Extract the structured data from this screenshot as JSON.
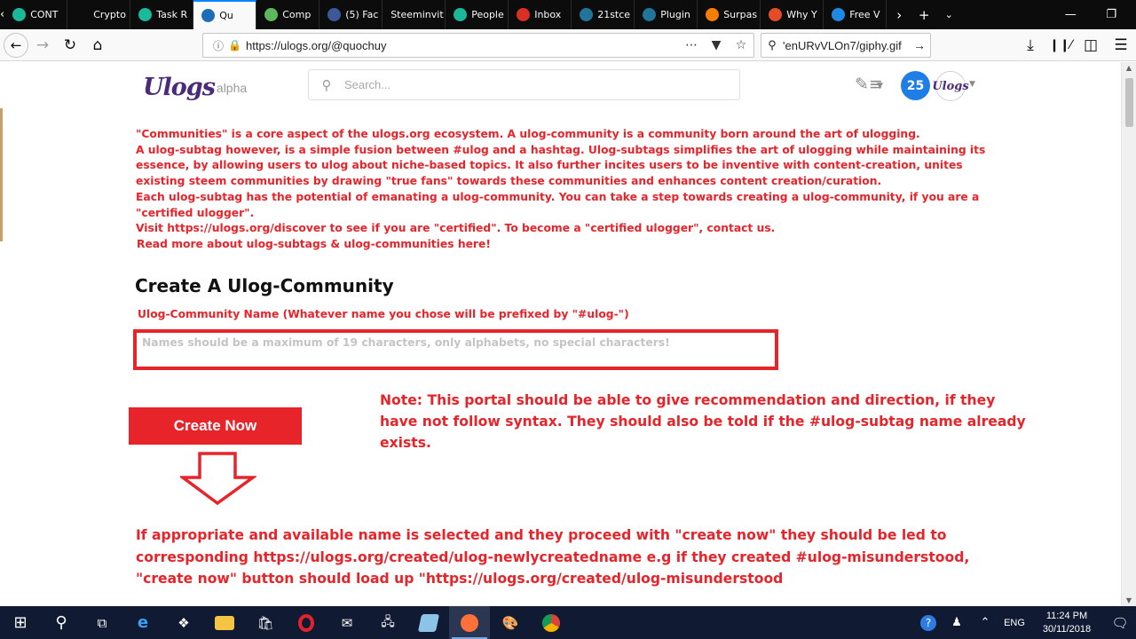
{
  "browser": {
    "tabs": [
      {
        "label": "CONT",
        "favicon": "circle-swirl-icon",
        "color": "#19b999",
        "active": false
      },
      {
        "label": "Crypto",
        "favicon": "crypto-icon",
        "color": "#0c0c0d",
        "active": false
      },
      {
        "label": "Task R",
        "favicon": "circle-swirl-icon",
        "color": "#19b999",
        "active": false
      },
      {
        "label": "Qu",
        "favicon": "ulogs-icon",
        "color": "#1c6fb7",
        "active": true
      },
      {
        "label": "Comp",
        "favicon": "leaf-icon",
        "color": "#5cb85c",
        "active": false
      },
      {
        "label": "(5) Fac",
        "favicon": "facebook-icon",
        "color": "#3b5998",
        "active": false
      },
      {
        "label": "Steeminvit",
        "favicon": "",
        "color": "#0c0c0d",
        "active": false
      },
      {
        "label": "People",
        "favicon": "circle-swirl-icon",
        "color": "#19b999",
        "active": false
      },
      {
        "label": "Inbox",
        "favicon": "gmail-icon",
        "color": "#d93025",
        "active": false
      },
      {
        "label": "21stce",
        "favicon": "wordpress-icon",
        "color": "#21759b",
        "active": false
      },
      {
        "label": "Plugin",
        "favicon": "wordpress-icon",
        "color": "#21759b",
        "active": false
      },
      {
        "label": "Surpas",
        "favicon": "blogger-icon",
        "color": "#f57d00",
        "active": false
      },
      {
        "label": "Why Y",
        "favicon": "chrome-like-icon",
        "color": "#e34c26",
        "active": false
      },
      {
        "label": "Free V",
        "favicon": "x-icon",
        "color": "#1e88e5",
        "active": false
      }
    ],
    "url": "https://ulogs.org/@quochuy",
    "search_value": "'enURvVLOn7/giphy.gif"
  },
  "site": {
    "logo_text": "Ulogs",
    "logo_badge": "alpha",
    "search_placeholder": "Search...",
    "notification_count": "25",
    "avatar_text": "Ulogs"
  },
  "intro": [
    "\"Communities\" is a core aspect of the ulogs.org ecosystem. A ulog-community is a community born around the art of ulogging.",
    "A ulog-subtag however, is a simple fusion between #ulog and a hashtag. Ulog-subtags simplifies the art of ulogging while maintaining its essence, by allowing users to ulog about niche-based topics. It also further incites users to be inventive with content-creation, unites existing steem communities by drawing \"true fans\" towards these communities and enhances content creation/curation.",
    "Each ulog-subtag has the potential of emanating a ulog-community. You can take a step towards creating a ulog-community, if you are a \"certified ulogger\".",
    "Visit https://ulogs.org/discover to see if you are \"certified\". To become a \"certified ulogger\", contact us.",
    "Read more about ulog-subtags & ulog-communities here!"
  ],
  "form": {
    "heading": "Create A Ulog-Community",
    "name_label": "Ulog-Community Name (Whatever name you chose will be prefixed by \"#ulog-\")",
    "name_placeholder": "Names should be a maximum of 19 characters, only alphabets, no special characters!",
    "name_value": "",
    "create_label": "Create Now"
  },
  "annotations": {
    "note": "Note: This portal should be able to give recommendation and direction, if they have not follow syntax. They should also be told if the #ulog-subtag name already exists.",
    "bottom": "If appropriate and available name is selected and they proceed with \"create now\" they should be led to corresponding https://ulogs.org/created/ulog-newlycreatedname e.g if they created #ulog-misunderstood, \"create now\" button should load up \"https://ulogs.org/created/ulog-misunderstood"
  },
  "taskbar": {
    "language": "ENG",
    "time": "11:24 PM",
    "date": "30/11/2018"
  },
  "colors": {
    "accent_red": "#e8242b",
    "browser_dark": "#0c0c0d",
    "taskbar": "#101b33",
    "notif_blue": "#1f7ee6"
  }
}
